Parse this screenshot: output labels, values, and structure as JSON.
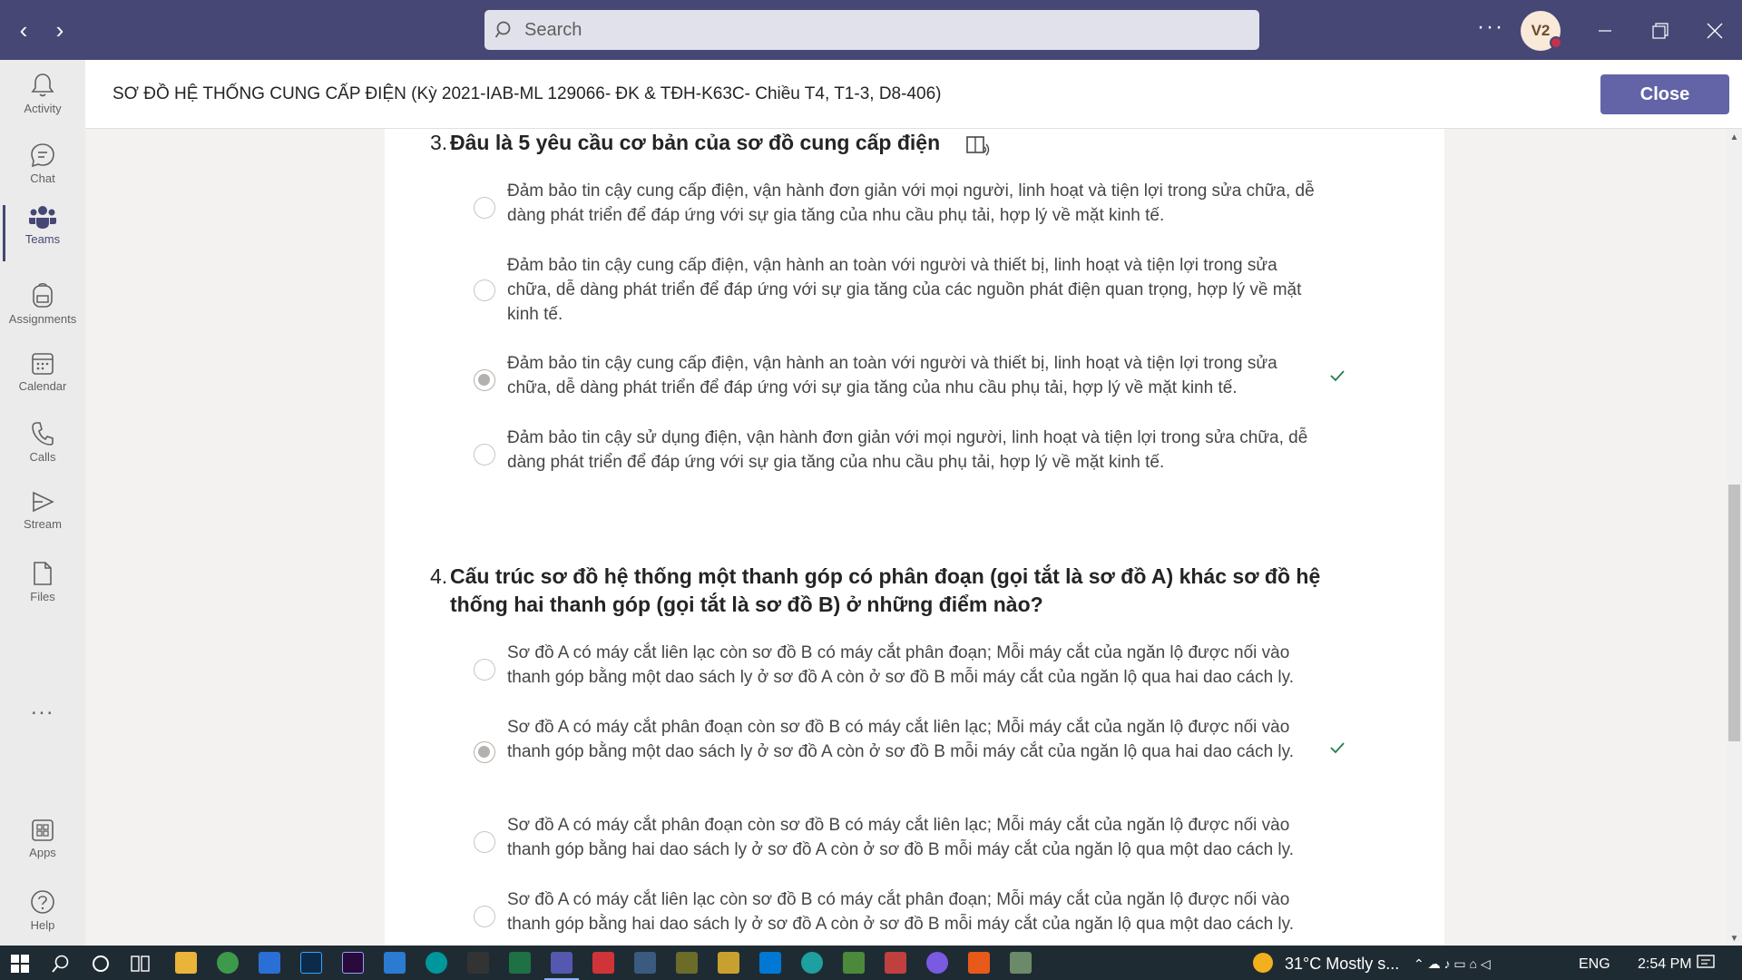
{
  "search": {
    "placeholder": "Search"
  },
  "account": {
    "initials": "V2"
  },
  "rail": {
    "items": [
      {
        "label": "Activity"
      },
      {
        "label": "Chat"
      },
      {
        "label": "Teams"
      },
      {
        "label": "Assignments"
      },
      {
        "label": "Calendar"
      },
      {
        "label": "Calls"
      },
      {
        "label": "Stream"
      },
      {
        "label": "Files"
      },
      {
        "label": "Apps"
      },
      {
        "label": "Help"
      }
    ],
    "more": "..."
  },
  "header": {
    "title": "SƠ ĐỒ HỆ THỐNG CUNG CẤP ĐIỆN (Kỳ 2021-IAB-ML 129066- ĐK & TĐH-K63C- Chiều T4, T1-3, D8-406)",
    "close_label": "Close"
  },
  "questions": [
    {
      "number": "3.",
      "title": "Đâu là 5 yêu cầu cơ bản của sơ đồ cung cấp điện",
      "options": [
        {
          "text": "Đảm bảo tin cậy cung cấp điện, vận hành đơn giản với mọi người, linh hoạt và tiện lợi trong sửa chữa, dễ dàng phát triển để đáp ứng với sự gia tăng của nhu cầu phụ tải, hợp lý về mặt kinh tế.",
          "selected": false,
          "correct": false
        },
        {
          "text": "Đảm bảo tin cậy cung cấp điện, vận hành an toàn với người và thiết bị, linh hoạt và tiện lợi trong sửa chữa, dễ dàng phát triển để đáp ứng với sự gia tăng của các nguồn phát điện quan trọng, hợp lý về mặt kinh tế.",
          "selected": false,
          "correct": false
        },
        {
          "text": "Đảm bảo tin cậy cung cấp điện, vận hành an toàn với người và thiết bị, linh hoạt và tiện lợi trong sửa chữa, dễ dàng phát triển để đáp ứng với sự gia tăng của nhu cầu phụ tải, hợp lý về mặt kinh tế.",
          "selected": true,
          "correct": true
        },
        {
          "text": "Đảm bảo tin cậy sử dụng điện, vận hành đơn giản với mọi người, linh hoạt và tiện lợi trong sửa chữa, dễ dàng phát triển để đáp ứng với sự gia tăng của nhu cầu phụ tải, hợp lý về mặt kinh tế.",
          "selected": false,
          "correct": false
        }
      ]
    },
    {
      "number": "4.",
      "title": "Cấu trúc sơ đồ hệ thống một thanh góp có phân đoạn (gọi tắt là sơ đồ A) khác sơ đồ hệ thống hai thanh góp (gọi tắt là sơ đồ B) ở những điểm nào?",
      "options": [
        {
          "text": "Sơ đồ A có máy cắt liên lạc còn sơ đồ B có máy cắt phân đoạn; Mỗi máy cắt của ngăn lộ được nối vào thanh góp bằng một dao sách ly ở sơ đồ A còn ở sơ đồ B mỗi máy cắt của ngăn lộ qua hai dao cách ly.",
          "selected": false,
          "correct": false
        },
        {
          "text": "Sơ đồ A có máy cắt phân đoạn còn sơ đồ B có máy cắt liên lạc; Mỗi máy cắt của ngăn lộ được nối vào thanh góp bằng một dao sách ly ở sơ đồ A còn ở sơ đồ B mỗi máy cắt của ngăn lộ qua hai dao cách ly.",
          "selected": true,
          "correct": true
        },
        {
          "text": "Sơ đồ A có máy cắt phân đoạn còn sơ đồ B có máy cắt liên lạc; Mỗi máy cắt của ngăn lộ được nối vào thanh góp bằng hai dao sách ly ở sơ đồ A còn ở sơ đồ B mỗi máy cắt của ngăn lộ qua một dao cách ly.",
          "selected": false,
          "correct": false
        },
        {
          "text": "Sơ đồ A có máy cắt liên lạc còn sơ đồ B có máy cắt phân đoạn; Mỗi máy cắt của ngăn lộ được nối vào thanh góp bằng hai dao sách ly ở sơ đồ A còn ở sơ đồ B mỗi máy cắt của ngăn lộ qua một dao cách ly.",
          "selected": false,
          "correct": false
        }
      ]
    }
  ],
  "taskbar": {
    "weather": "31°C  Mostly s...",
    "language": "ENG",
    "time": "2:54 PM"
  },
  "colors": {
    "titlebar": "#464775",
    "accent": "#6264a7",
    "correct": "#237b4b",
    "taskbar": "#1f2b33"
  }
}
